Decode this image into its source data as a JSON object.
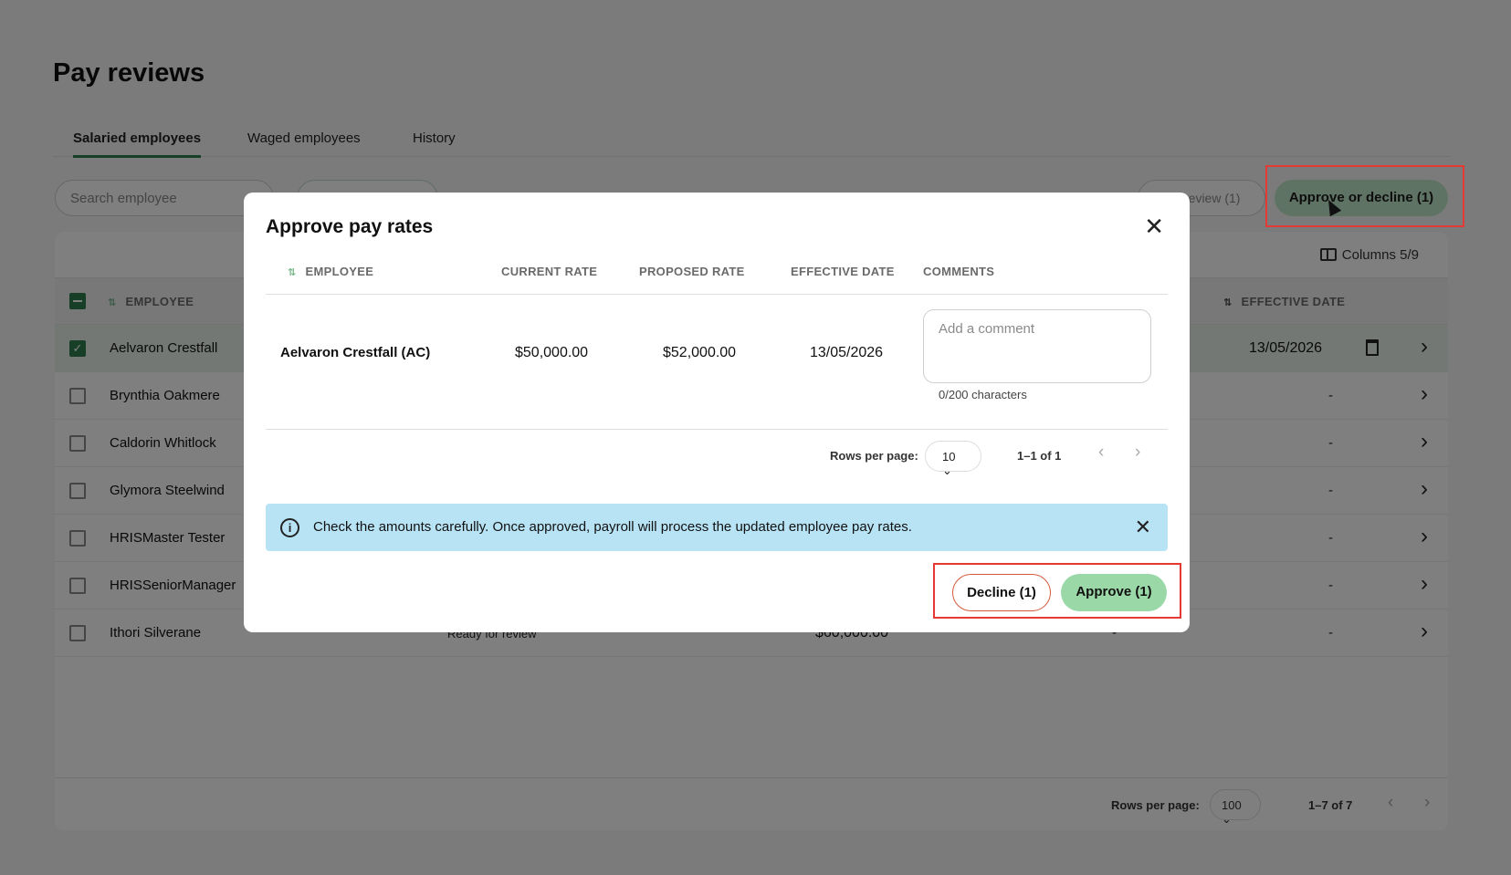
{
  "page": {
    "title": "Pay reviews",
    "tabs": [
      "Salaried employees",
      "Waged employees",
      "History"
    ],
    "search_placeholder": "Search employee",
    "review_button": "review (1)",
    "approve_decline_button": "Approve or decline (1)",
    "columns_button": "Columns 5/9"
  },
  "table": {
    "headers": {
      "employee": "EMPLOYEE",
      "effective_date": "EFFECTIVE DATE"
    },
    "rows": [
      {
        "name": "Aelvaron Crestfall",
        "effective": "13/05/2026",
        "selected": true
      },
      {
        "name": "Brynthia Oakmere",
        "effective": "-"
      },
      {
        "name": "Caldorin Whitlock",
        "effective": "-"
      },
      {
        "name": "Glymora Steelwind",
        "effective": "-"
      },
      {
        "name": "HRISMaster Tester",
        "effective": "-"
      },
      {
        "name": "HRISSeniorManager",
        "effective": "-"
      },
      {
        "name": "Ithori Silverane",
        "status": "Ready for review",
        "rate": "$60,000.00",
        "dash": "-",
        "effective": "-"
      }
    ],
    "pager": {
      "rows_per_page_label": "Rows per page:",
      "rows_per_page": "100",
      "range": "1–7 of 7"
    }
  },
  "modal": {
    "title": "Approve pay rates",
    "headers": {
      "employee": "EMPLOYEE",
      "current_rate": "CURRENT RATE",
      "proposed_rate": "PROPOSED RATE",
      "effective_date": "EFFECTIVE DATE",
      "comments": "COMMENTS"
    },
    "row": {
      "employee": "Aelvaron Crestfall (AC)",
      "current_rate": "$50,000.00",
      "proposed_rate": "$52,000.00",
      "effective_date": "13/05/2026",
      "comment_placeholder": "Add a comment",
      "char_count": "0/200 characters"
    },
    "pager": {
      "rows_per_page_label": "Rows per page:",
      "rows_per_page": "10",
      "range": "1–1 of 1"
    },
    "info_message": "Check the amounts carefully. Once approved, payroll will process the updated employee pay rates.",
    "decline_label": "Decline (1)",
    "approve_label": "Approve (1)"
  },
  "colors": {
    "accent": "#2e7d4f",
    "approve": "#9ad8a7",
    "info": "#b8e3f5",
    "highlight": "#e53935"
  }
}
